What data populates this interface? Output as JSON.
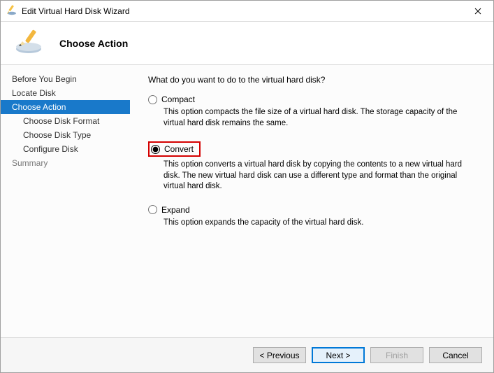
{
  "window": {
    "title": "Edit Virtual Hard Disk Wizard"
  },
  "header": {
    "title": "Choose Action"
  },
  "sidebar": {
    "items": [
      {
        "label": "Before You Begin",
        "selected": false,
        "sub": false
      },
      {
        "label": "Locate Disk",
        "selected": false,
        "sub": false
      },
      {
        "label": "Choose Action",
        "selected": true,
        "sub": false
      },
      {
        "label": "Choose Disk Format",
        "selected": false,
        "sub": true
      },
      {
        "label": "Choose Disk Type",
        "selected": false,
        "sub": true
      },
      {
        "label": "Configure Disk",
        "selected": false,
        "sub": true
      },
      {
        "label": "Summary",
        "selected": false,
        "sub": false,
        "disabled": true
      }
    ]
  },
  "content": {
    "question": "What do you want to do to the virtual hard disk?",
    "options": [
      {
        "id": "compact",
        "label": "Compact",
        "checked": false,
        "highlight": false,
        "description": "This option compacts the file size of a virtual hard disk. The storage capacity of the virtual hard disk remains the same."
      },
      {
        "id": "convert",
        "label": "Convert",
        "checked": true,
        "highlight": true,
        "description": "This option converts a virtual hard disk by copying the contents to a new virtual hard disk. The new virtual hard disk can use a different type and format than the original virtual hard disk."
      },
      {
        "id": "expand",
        "label": "Expand",
        "checked": false,
        "highlight": false,
        "description": "This option expands the capacity of the virtual hard disk."
      }
    ]
  },
  "footer": {
    "previous": "< Previous",
    "next": "Next >",
    "finish": "Finish",
    "cancel": "Cancel"
  }
}
